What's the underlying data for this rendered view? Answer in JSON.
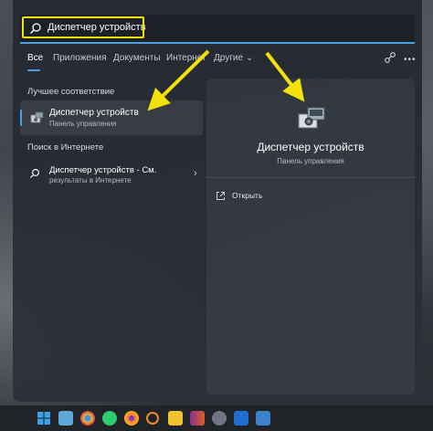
{
  "search": {
    "query": "Диспетчер устройств"
  },
  "tabs": [
    {
      "label": "Все"
    },
    {
      "label": "Приложения"
    },
    {
      "label": "Документы"
    },
    {
      "label": "Интернет"
    },
    {
      "label": "Другие"
    }
  ],
  "left": {
    "best_match_title": "Лучшее соответствие",
    "best_match": {
      "title": "Диспетчер устройств",
      "subtitle": "Панель управления"
    },
    "web_section_title": "Поиск в Интернете",
    "web_result": {
      "title": "Диспетчер устройств - См.",
      "subtitle": "результаты в Интернете"
    }
  },
  "preview": {
    "title": "Диспетчер устройств",
    "subtitle": "Панель управления",
    "open_label": "Открыть"
  },
  "colors": {
    "accent": "#4aa3df",
    "highlight": "#f2e20a"
  },
  "taskbar_icons": [
    "windows-icon",
    "photos-icon",
    "chrome-icon",
    "whatsapp-icon",
    "firefox-icon",
    "search-app-icon",
    "explorer-icon",
    "winrar-icon",
    "settings-icon",
    "mail-icon",
    "other-icon"
  ]
}
